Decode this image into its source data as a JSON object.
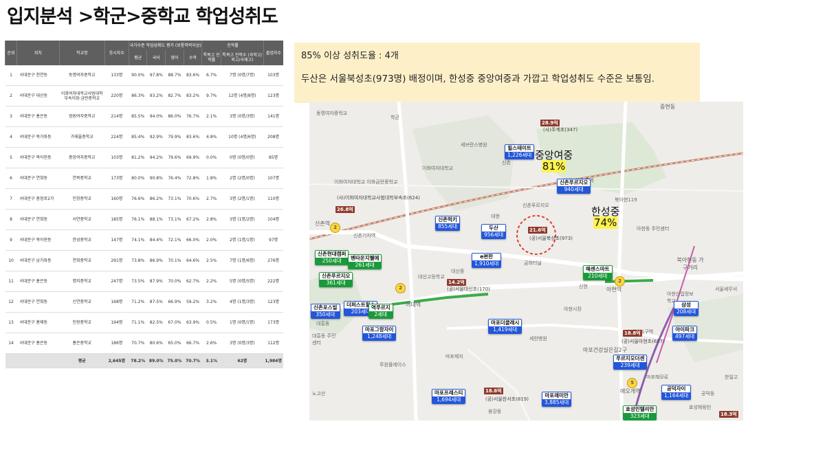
{
  "page_title": "입지분석 >학군>중학교 학업성취도",
  "table": {
    "head_top": {
      "rank": "순위",
      "location": "위치",
      "school": "학교명",
      "students": "응시자수",
      "eval_group": "국가수준 학업성취도 평가 (보통학력이상)",
      "advance_group": "진학률",
      "graduates": "졸업자수"
    },
    "head_sub": {
      "avg": "평균",
      "korean": "국어",
      "english": "영어",
      "math": "수학",
      "special": "특목고 진학률",
      "special_count": "특목고 진학수 (과학고/외고/국제고)"
    },
    "rows": [
      [
        "1",
        "서대문구 천연동",
        "동명여자중학교",
        "133명",
        "90.0%",
        "97.8%",
        "88.7%",
        "83.6%",
        "6.7%",
        "7명 (0명/7명)",
        "103명"
      ],
      [
        "2",
        "서대문구 대신동",
        "이화여자대학교사범대학부속이화·금란중학교",
        "220명",
        "86.3%",
        "93.2%",
        "82.7%",
        "83.2%",
        "9.7%",
        "12명 (4명/8명)",
        "123명"
      ],
      [
        "3",
        "서대문구 홍은동",
        "정원여자중학교",
        "214명",
        "85.5%",
        "94.0%",
        "86.0%",
        "76.7%",
        "2.1%",
        "3명 (0명/3명)",
        "141명"
      ],
      [
        "4",
        "서대문구 북가좌동",
        "가재울중학교",
        "224명",
        "85.4%",
        "92.9%",
        "79.9%",
        "83.6%",
        "4.8%",
        "10명 (4명/6명)",
        "208명"
      ],
      [
        "5",
        "서대문구 북아현동",
        "중앙여자중학교",
        "103명",
        "81.2%",
        "94.2%",
        "79.6%",
        "69.9%",
        "0.0%",
        "0명 (0명/0명)",
        "85명"
      ],
      [
        "6",
        "서대문구 연희동",
        "연북중학교",
        "173명",
        "80.0%",
        "90.8%",
        "76.4%",
        "72.8%",
        "1.8%",
        "2명 (2명/0명)",
        "107명"
      ],
      [
        "7",
        "서대문구 충정로2가",
        "인창중학교",
        "160명",
        "76.6%",
        "86.2%",
        "73.1%",
        "70.6%",
        "2.7%",
        "3명 (2명/1명)",
        "110명"
      ],
      [
        "8",
        "서대문구 연희동",
        "서연중학교",
        "185명",
        "76.1%",
        "88.1%",
        "73.1%",
        "67.2%",
        "2.8%",
        "3명 (1명/2명)",
        "104명"
      ],
      [
        "9",
        "서대문구 북아현동",
        "한성중학교",
        "147명",
        "74.1%",
        "84.4%",
        "72.1%",
        "66.0%",
        "2.0%",
        "2명 (1명/1명)",
        "97명"
      ],
      [
        "10",
        "서대문구 남가좌동",
        "연희중학교",
        "291명",
        "73.8%",
        "86.9%",
        "70.1%",
        "64.6%",
        "2.5%",
        "7명 (1명/6명)",
        "276명"
      ],
      [
        "11",
        "서대문구 홍은동",
        "명지중학교",
        "247명",
        "73.5%",
        "87.9%",
        "70.0%",
        "62.7%",
        "2.2%",
        "5명 (0명/5명)",
        "222명"
      ],
      [
        "12",
        "서대문구 연희동",
        "신연중학교",
        "168명",
        "71.2%",
        "87.5%",
        "66.9%",
        "59.2%",
        "3.2%",
        "4명 (1명/3명)",
        "123명"
      ],
      [
        "13",
        "서대문구 홍제동",
        "인왕중학교",
        "194명",
        "71.1%",
        "82.5%",
        "67.0%",
        "63.9%",
        "0.5%",
        "1명 (0명/1명)",
        "173명"
      ],
      [
        "14",
        "서대문구 홍은동",
        "홍은중학교",
        "186명",
        "70.7%",
        "80.6%",
        "65.0%",
        "66.7%",
        "2.6%",
        "3명 (0명/3명)",
        "112명"
      ]
    ],
    "avg_row": [
      "평균",
      "2,645명",
      "78.2%",
      "89.0%",
      "75.0%",
      "70.7%",
      "3.1%",
      "62명",
      "1,984명"
    ]
  },
  "info": {
    "line1": "85% 이상 성취도율 : 4개",
    "line2": "두산은 서울북성초(973명) 배정이며, 한성중 중앙여중과 가깝고 학업성취도 수준은 보통임."
  },
  "map": {
    "annotations": [
      {
        "name": "중앙여중",
        "pct": "81%"
      },
      {
        "name": "한성중",
        "pct": "74%"
      }
    ],
    "complexes": [
      {
        "name": "힐스테이트",
        "households": "1,226세대",
        "color": "blue"
      },
      {
        "name": "신촌푸르지오",
        "households": "940세대",
        "color": "blue"
      },
      {
        "name": "신촌럭키",
        "households": "855세대",
        "color": "blue"
      },
      {
        "name": "두산",
        "households": "956세대",
        "color": "blue"
      },
      {
        "name": "e편한",
        "households": "1,910세대",
        "color": "blue"
      },
      {
        "name": "신촌현대캠퍼",
        "households": "250세대",
        "color": "green"
      },
      {
        "name": "벤타운지웰에",
        "households": "261세대",
        "color": "green"
      },
      {
        "name": "신촌푸르지오",
        "households": "361세대",
        "color": "green"
      },
      {
        "name": "해센스마트",
        "households": "210세대",
        "color": "green"
      },
      {
        "name": "신촌포스빌",
        "households": "350세대",
        "color": "blue"
      },
      {
        "name": "더퍼스트힐스",
        "households": "203세대",
        "color": "blue"
      },
      {
        "name": "역푸르지",
        "households": "2세대",
        "color": "green"
      },
      {
        "name": "마포그랑자이",
        "households": "1,248세대",
        "color": "blue"
      },
      {
        "name": "마포더클래시",
        "households": "1,419세대",
        "color": "blue"
      },
      {
        "name": "삼성",
        "households": "208세대",
        "color": "blue"
      },
      {
        "name": "아이파크",
        "households": "497세대",
        "color": "blue"
      },
      {
        "name": "푸르지오더센",
        "households": "239세대",
        "color": "blue"
      },
      {
        "name": "마포프레스티",
        "households": "1,694세대",
        "color": "blue"
      },
      {
        "name": "마포래미안",
        "households": "3,885세대",
        "color": "blue"
      },
      {
        "name": "공덕자이",
        "households": "1,164세대",
        "color": "blue"
      },
      {
        "name": "효성인텔리안",
        "households": "323세대",
        "color": "green"
      }
    ],
    "schools": [
      "(사)주계초(347)",
      "(사)이화여자대학교사범대학부속초(624)",
      "(공)서울북성초(973)",
      "(공)서울대신초(170)",
      "(공)서울아현초(657)",
      "(공)서울한서초(819)"
    ],
    "flags": [
      "28.9억",
      "26.8억",
      "21.6억",
      "14.2억",
      "18.8억",
      "18.6억",
      "18.3억"
    ],
    "place_labels": [
      {
        "text": "중앙여자",
        "kind": "road"
      },
      {
        "text": "중현동",
        "kind": "area"
      },
      {
        "text": "신촌역",
        "kind": "area"
      },
      {
        "text": "이대역",
        "kind": "area"
      },
      {
        "text": "아현역",
        "kind": "area"
      },
      {
        "text": "애오개역",
        "kind": "area"
      },
      {
        "text": "북아현동 가구거리",
        "kind": "area"
      },
      {
        "text": "마포건강실은길2구",
        "kind": "area"
      },
      {
        "text": "아현시장",
        "kind": "area"
      },
      {
        "text": "신촌",
        "kind": "area"
      },
      {
        "text": "마포제지",
        "kind": "area"
      },
      {
        "text": "이화여자대학교",
        "kind": "area"
      },
      {
        "text": "이화여자대학교 이화금란중학교",
        "kind": "area"
      },
      {
        "text": "루원플레이스",
        "kind": "area"
      },
      {
        "text": "대흥동 주민센터",
        "kind": "area"
      },
      {
        "text": "세브란스병원",
        "kind": "area"
      },
      {
        "text": "신촌푸르지오",
        "kind": "area"
      },
      {
        "text": "대신중",
        "kind": "area"
      },
      {
        "text": "대신고등학교",
        "kind": "area"
      },
      {
        "text": "이대",
        "kind": "area"
      },
      {
        "text": "금화터널",
        "kind": "area"
      },
      {
        "text": "신현",
        "kind": "area"
      },
      {
        "text": "아현동 주민센터",
        "kind": "area"
      },
      {
        "text": "북아현119",
        "kind": "area"
      },
      {
        "text": "아현산업정보학교",
        "kind": "area"
      },
      {
        "text": "마포해모로",
        "kind": "area"
      },
      {
        "text": "세란병원",
        "kind": "area"
      },
      {
        "text": "대흥동",
        "kind": "area"
      },
      {
        "text": "공덕동",
        "kind": "area"
      },
      {
        "text": "신촌기차역",
        "kind": "area"
      },
      {
        "text": "대현",
        "kind": "area"
      },
      {
        "text": "아현1구역",
        "kind": "area"
      },
      {
        "text": "북아현1-3구역",
        "kind": "area"
      },
      {
        "text": "노고산",
        "kind": "area"
      },
      {
        "text": "한일고",
        "kind": "area"
      },
      {
        "text": "효성해링턴",
        "kind": "area"
      },
      {
        "text": "서울세무서",
        "kind": "area"
      },
      {
        "text": "용강동",
        "kind": "area"
      },
      {
        "text": "동명여자중학교",
        "kind": "area"
      },
      {
        "text": "학군",
        "kind": "area"
      }
    ]
  }
}
